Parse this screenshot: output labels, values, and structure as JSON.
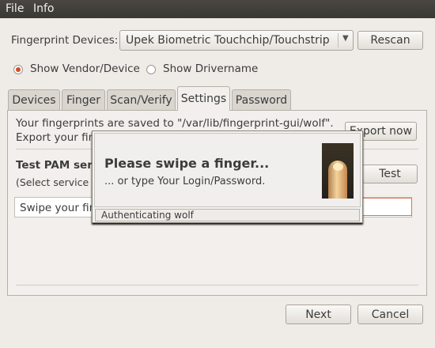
{
  "menubar": {
    "file": "File",
    "info": "Info"
  },
  "devices": {
    "label": "Fingerprint Devices:",
    "selected": "Upek Biometric Touchchip/Touchstrip Fingerprint Sensor",
    "rescan": "Rescan"
  },
  "options": {
    "vendor": "Show Vendor/Device",
    "drivername": "Show Drivername"
  },
  "tabs": [
    "Devices",
    "Finger",
    "Scan/Verify",
    "Settings",
    "Password"
  ],
  "settings": {
    "save_line1": "Your fingerprints are saved to \"/var/lib/fingerprint-gui/wolf\".",
    "save_line2": "Export your fing",
    "export": "Export now",
    "pam_title": "Test PAM ser",
    "pam_hint": "(Select service t",
    "test": "Test",
    "swipe_field": "Swipe your fin"
  },
  "popup": {
    "title": "Please swipe a finger...",
    "subtitle": "... or type Your Login/Password.",
    "status": "Authenticating wolf"
  },
  "footer": {
    "next": "Next",
    "cancel": "Cancel"
  }
}
